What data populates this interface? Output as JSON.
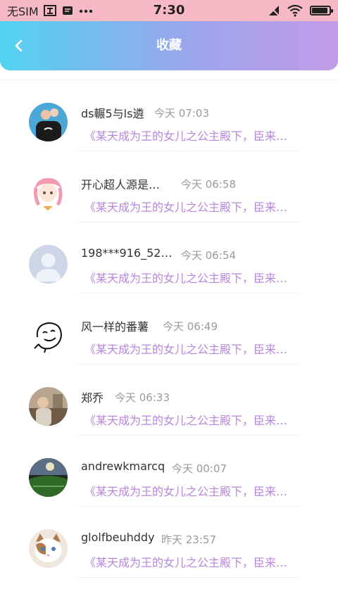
{
  "status_bar": {
    "carrier": "无SIM",
    "time": "7:30"
  },
  "nav": {
    "title": "收藏"
  },
  "favorites": [
    {
      "name": "ds輾5与ls遴",
      "time": "今天 07:03",
      "quote": "《某天成为王的女儿之公主殿下，臣来…",
      "avatar_icon": "user-photo"
    },
    {
      "name": "开心超人源是…",
      "time": "今天 06:58",
      "quote": "《某天成为王的女儿之公主殿下，臣来…",
      "avatar_icon": "anime-girl"
    },
    {
      "name": "198***916_52…",
      "time": "今天 06:54",
      "quote": "《某天成为王的女儿之公主殿下，臣来…",
      "avatar_icon": "default-user"
    },
    {
      "name": "风一样的番薯",
      "time": "今天 06:49",
      "quote": "《某天成为王的女儿之公主殿下，臣来…",
      "avatar_icon": "sketch-face"
    },
    {
      "name": "郑乔",
      "time": "今天 06:33",
      "quote": "《某天成为王的女儿之公主殿下，臣来…",
      "avatar_icon": "user-photo"
    },
    {
      "name": "andrewkmarcq",
      "time": "今天 00:07",
      "quote": "《某天成为王的女儿之公主殿下，臣来…",
      "avatar_icon": "stadium-photo"
    },
    {
      "name": "glolfbeuhddy",
      "time": "昨天 23:57",
      "quote": "《某天成为王的女儿之公主殿下，臣来…",
      "avatar_icon": "cat-photo"
    }
  ],
  "colors": {
    "status_bg": "#f7b9c6",
    "nav_gradient_start": "#51d3f0",
    "nav_gradient_end": "#c39be8",
    "quote": "#b786dc"
  }
}
